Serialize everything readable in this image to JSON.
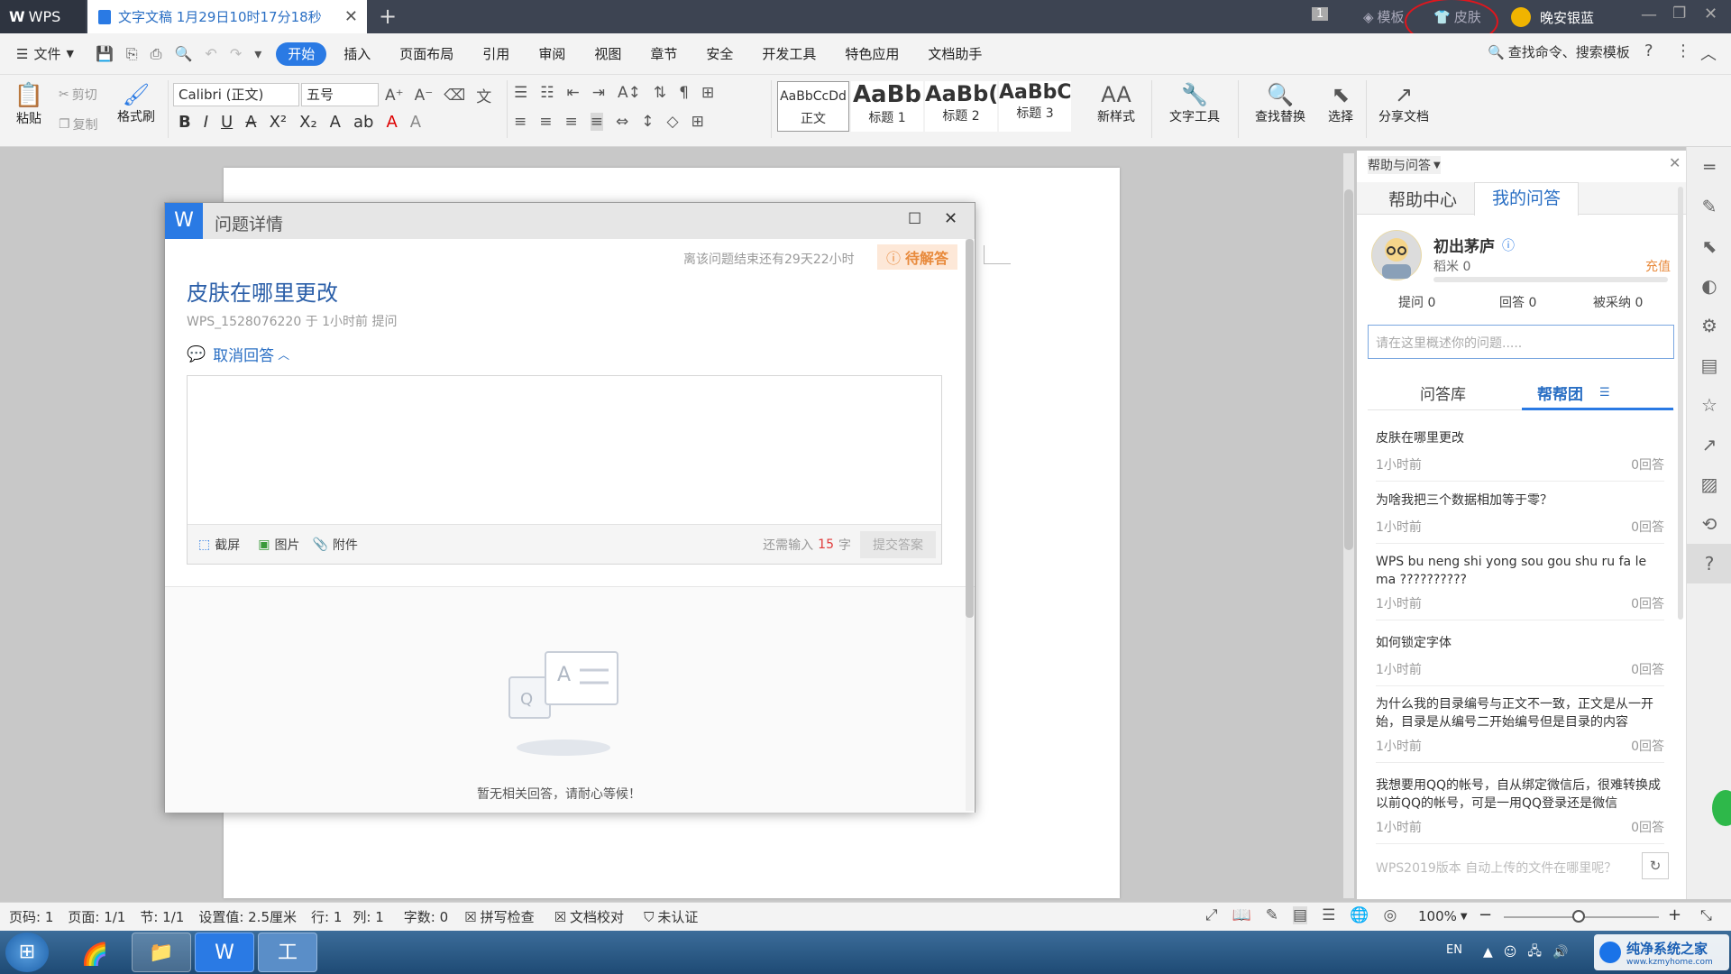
{
  "titlebar": {
    "app_tab": "WPS",
    "doc_tab": "文字文稿 1月29日10时17分18秒",
    "page_indicator": "1",
    "template": "模板",
    "skin": "皮肤",
    "user": "晚安银蓝"
  },
  "menubar": {
    "file": "文件",
    "items": [
      "开始",
      "插入",
      "页面布局",
      "引用",
      "审阅",
      "视图",
      "章节",
      "安全",
      "开发工具",
      "特色应用",
      "文档助手"
    ],
    "search": "查找命令、搜索模板"
  },
  "ribbon": {
    "paste": "粘贴",
    "cut": "剪切",
    "copy": "复制",
    "format_painter": "格式刷",
    "font_name": "Calibri (正文)",
    "font_size": "五号",
    "styles": [
      {
        "preview": "AaBbCcDd",
        "name": "正文"
      },
      {
        "preview": "AaBb",
        "name": "标题 1"
      },
      {
        "preview": "AaBb(",
        "name": "标题 2"
      },
      {
        "preview": "AaBbC",
        "name": "标题 3"
      }
    ],
    "new_style": "新样式",
    "text_tools": "文字工具",
    "find_replace": "查找替换",
    "select": "选择",
    "share": "分享文档"
  },
  "dialog": {
    "title": "问题详情",
    "countdown": "离该问题结束还有29天22小时",
    "status": "待解答",
    "question": "皮肤在哪里更改",
    "asker_meta": "WPS_1528076220 于 1小时前 提问",
    "cancel_answer": "取消回答",
    "screenshot": "截屏",
    "image": "图片",
    "attachment": "附件",
    "remaining_prefix": "还需输入",
    "remaining_count": "15",
    "remaining_suffix": "字",
    "submit": "提交答案",
    "empty_text": "暂无相关回答，请耐心等候！"
  },
  "panel": {
    "title": "帮助与问答",
    "tab_help": "帮助中心",
    "tab_mine": "我的问答",
    "username": "初出茅庐",
    "rice": "稻米 0",
    "recharge": "充值",
    "asked": "提问 0",
    "answered": "回答 0",
    "adopted": "被采纳 0",
    "input_placeholder": "请在这里概述你的问题.....",
    "subtab_library": "问答库",
    "subtab_help": "帮帮团",
    "questions": [
      {
        "title": "皮肤在哪里更改",
        "time": "1小时前",
        "answers": "0回答"
      },
      {
        "title": "为啥我把三个数据相加等于零？",
        "time": "1小时前",
        "answers": "0回答"
      },
      {
        "title": "WPS bu neng shi yong sou gou shu ru fa le ma ??????????",
        "time": "1小时前",
        "answers": "0回答"
      },
      {
        "title": "如何锁定字体",
        "time": "1小时前",
        "answers": "0回答"
      },
      {
        "title": "为什么我的目录编号与正文不一致，正文是从一开始，目录是从编号二开始编号但是目录的内容",
        "time": "1小时前",
        "answers": "0回答"
      },
      {
        "title": "我想要用QQ的帐号，自从绑定微信后，很难转换成以前QQ的帐号，可是一用QQ登录还是微信",
        "time": "1小时前",
        "answers": "0回答"
      },
      {
        "title": "WPS2019版本 自动上传的文件在哪里呢？",
        "time": "",
        "answers": ""
      }
    ]
  },
  "statusbar": {
    "page_num": "页码: 1",
    "pages": "页面: 1/1",
    "section": "节: 1/1",
    "setting": "设置值: 2.5厘米",
    "row": "行: 1",
    "col": "列: 1",
    "words": "字数: 0",
    "spell": "拼写检查",
    "proof": "文档校对",
    "cert": "未认证",
    "zoom": "100%"
  },
  "taskbar": {
    "lang": "EN"
  },
  "watermark": {
    "name": "纯净系统之家",
    "url": "www.kzmyhome.com"
  }
}
